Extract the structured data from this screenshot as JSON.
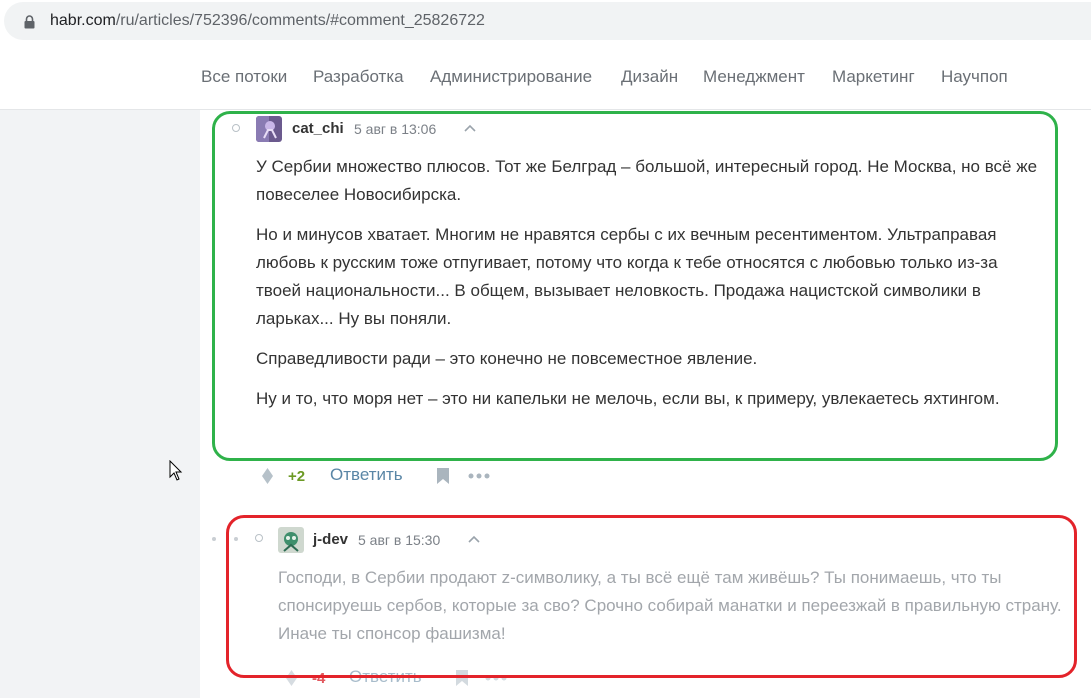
{
  "browser": {
    "url_host": "habr.com",
    "url_path": "/ru/articles/752396/comments/#comment_25826722"
  },
  "nav": {
    "items": [
      "Все потоки",
      "Разработка",
      "Администрирование",
      "Дизайн",
      "Менеджмент",
      "Маркетинг",
      "Научпоп"
    ]
  },
  "comments": [
    {
      "author": "cat_chi",
      "time": "5 авг в 13:06",
      "paragraphs": [
        "У Сербии множество плюсов. Тот же Белград – большой, интересный город. Не Москва, но всё же повеселее Новосибирска.",
        "Но и минусов хватает. Многим не нравятся сербы с их вечным ресентиментом. Ультраправая любовь к русским тоже отпугивает, потому что когда к тебе относятся с любовью только из-за твоей национальности... В общем, вызывает неловкость. Продажа нацистской символики в ларьках... Ну вы поняли.",
        "Справедливости ради – это конечно не повсеместное явление.",
        "Ну и то, что моря нет – это ни капельки не мелочь, если вы, к примеру, увлекаетесь яхтингом."
      ],
      "votes": "+2",
      "votes_color": "#6c9a25",
      "reply_label": "Ответить",
      "highlight": "green"
    },
    {
      "author": "j-dev",
      "time": "5 авг в 15:30",
      "paragraphs": [
        "Господи, в Сербии продают z-символику, а ты всё ещё там живёшь? Ты понимаешь, что ты спонсируешь сербов, которые за сво? Срочно собирай манатки и переезжай в правильную страну. Иначе ты спонсор фашизма!"
      ],
      "votes": "-4",
      "votes_color": "#e2595f",
      "reply_label": "Ответить",
      "highlight": "red",
      "collapsed_low_rating": true
    }
  ],
  "icons": {
    "lock": "lock-icon",
    "vote": "vote-diamond-icon",
    "bookmark": "bookmark-icon",
    "more": "more-dots-icon",
    "parent": "parent-comment-caret-icon"
  },
  "colors": {
    "highlight_green": "#2fb24a",
    "highlight_red": "#e3232a",
    "reply_link": "#5a86a6"
  }
}
